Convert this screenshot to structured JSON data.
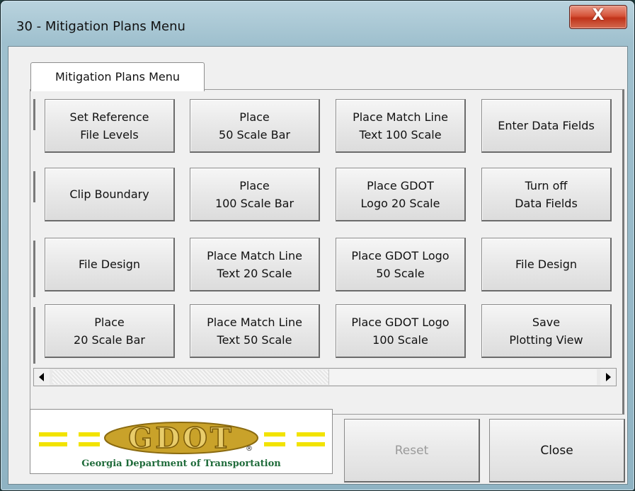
{
  "window": {
    "title": "30 - Mitigation Plans Menu",
    "close_glyph": "X",
    "close_icon": "close-icon"
  },
  "tab": {
    "label": "Mitigation Plans Menu"
  },
  "buttons": [
    [
      "Set Reference\nFile Levels",
      "Place\n50 Scale Bar",
      "Place Match Line\nText 100 Scale",
      "Enter Data Fields"
    ],
    [
      "Clip Boundary",
      "Place\n100 Scale Bar",
      "Place GDOT\nLogo 20 Scale",
      "Turn off\nData Fields"
    ],
    [
      "File Design",
      "Place Match Line\nText 20 Scale",
      "Place GDOT Logo\n50 Scale",
      "File Design"
    ],
    [
      "Place\n20 Scale Bar",
      "Place Match Line\nText 50 Scale",
      "Place GDOT Logo\n100 Scale",
      "Save\nPlotting View"
    ]
  ],
  "scrollbar": {
    "left_icon": "scroll-left-icon",
    "right_icon": "scroll-right-icon"
  },
  "logo": {
    "wordmark": "GDOT",
    "caption": "Georgia Department of Transportation",
    "registered": "®"
  },
  "footer": {
    "reset_label": "Reset",
    "close_label": "Close"
  },
  "colors": {
    "logo_gold": "#c9a22a",
    "logo_green": "#1f6b3a",
    "logo_yellow": "#f2e300",
    "close_red": "#c7381d"
  }
}
